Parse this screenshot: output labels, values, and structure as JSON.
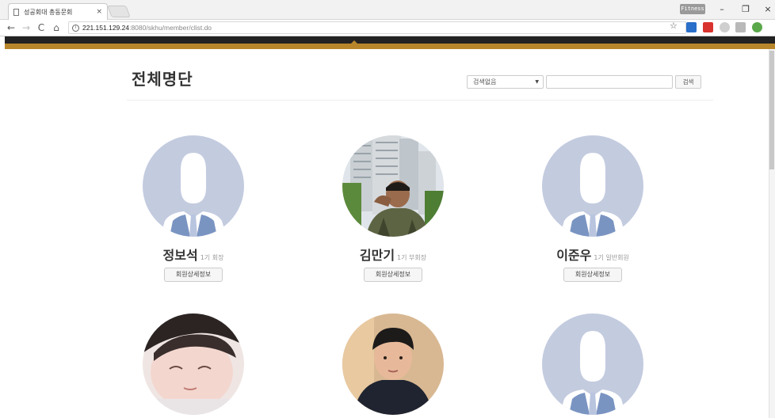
{
  "browser": {
    "tab_title": "성공회대 총동문회",
    "tab_close": "×",
    "profile_label": "Fitness",
    "url_host": "221.151.129.24",
    "url_path": ":8080/skhu/member/clist.do",
    "nav": {
      "back": "←",
      "forward": "→",
      "reload": "C",
      "home": "⌂"
    },
    "star": "☆",
    "window": {
      "minimize": "–",
      "restore": "❐",
      "close": "×"
    }
  },
  "page": {
    "title": "전체명단",
    "search": {
      "select_value": "검색없음",
      "input_value": "",
      "button_label": "검색"
    }
  },
  "members": [
    {
      "name": "정보석",
      "role": "1기 회장",
      "photo": "default-silhouette",
      "button": "회원상세정보"
    },
    {
      "name": "김만기",
      "role": "1기 부회장",
      "photo": "photo-salute-apartments",
      "button": "회원상세정보"
    },
    {
      "name": "이준우",
      "role": "1기 일반회원",
      "photo": "default-silhouette",
      "button": "회원상세정보"
    },
    {
      "name": "",
      "role": "",
      "photo": "photo-face-closeup",
      "button": ""
    },
    {
      "name": "",
      "role": "",
      "photo": "photo-boy-portrait",
      "button": ""
    },
    {
      "name": "",
      "role": "",
      "photo": "default-silhouette",
      "button": ""
    }
  ],
  "colors": {
    "header_dark": "#222222",
    "header_gold": "#b8862a",
    "avatar_bg": "#c3cbdf",
    "avatar_tie": "#7a94c2"
  }
}
